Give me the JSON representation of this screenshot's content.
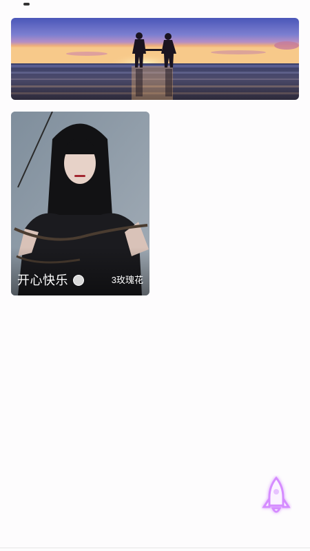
{
  "banner": {
    "image": "beach-sunset-couple"
  },
  "cards": [
    {
      "name": "开心快乐",
      "status": "offline",
      "status_color": "#d9d9d9",
      "gift_text": "3玫瑰花",
      "image": "girl-with-rope-photo"
    }
  ],
  "fab": {
    "icon": "rocket-icon",
    "glow_color": "#c77dff"
  }
}
